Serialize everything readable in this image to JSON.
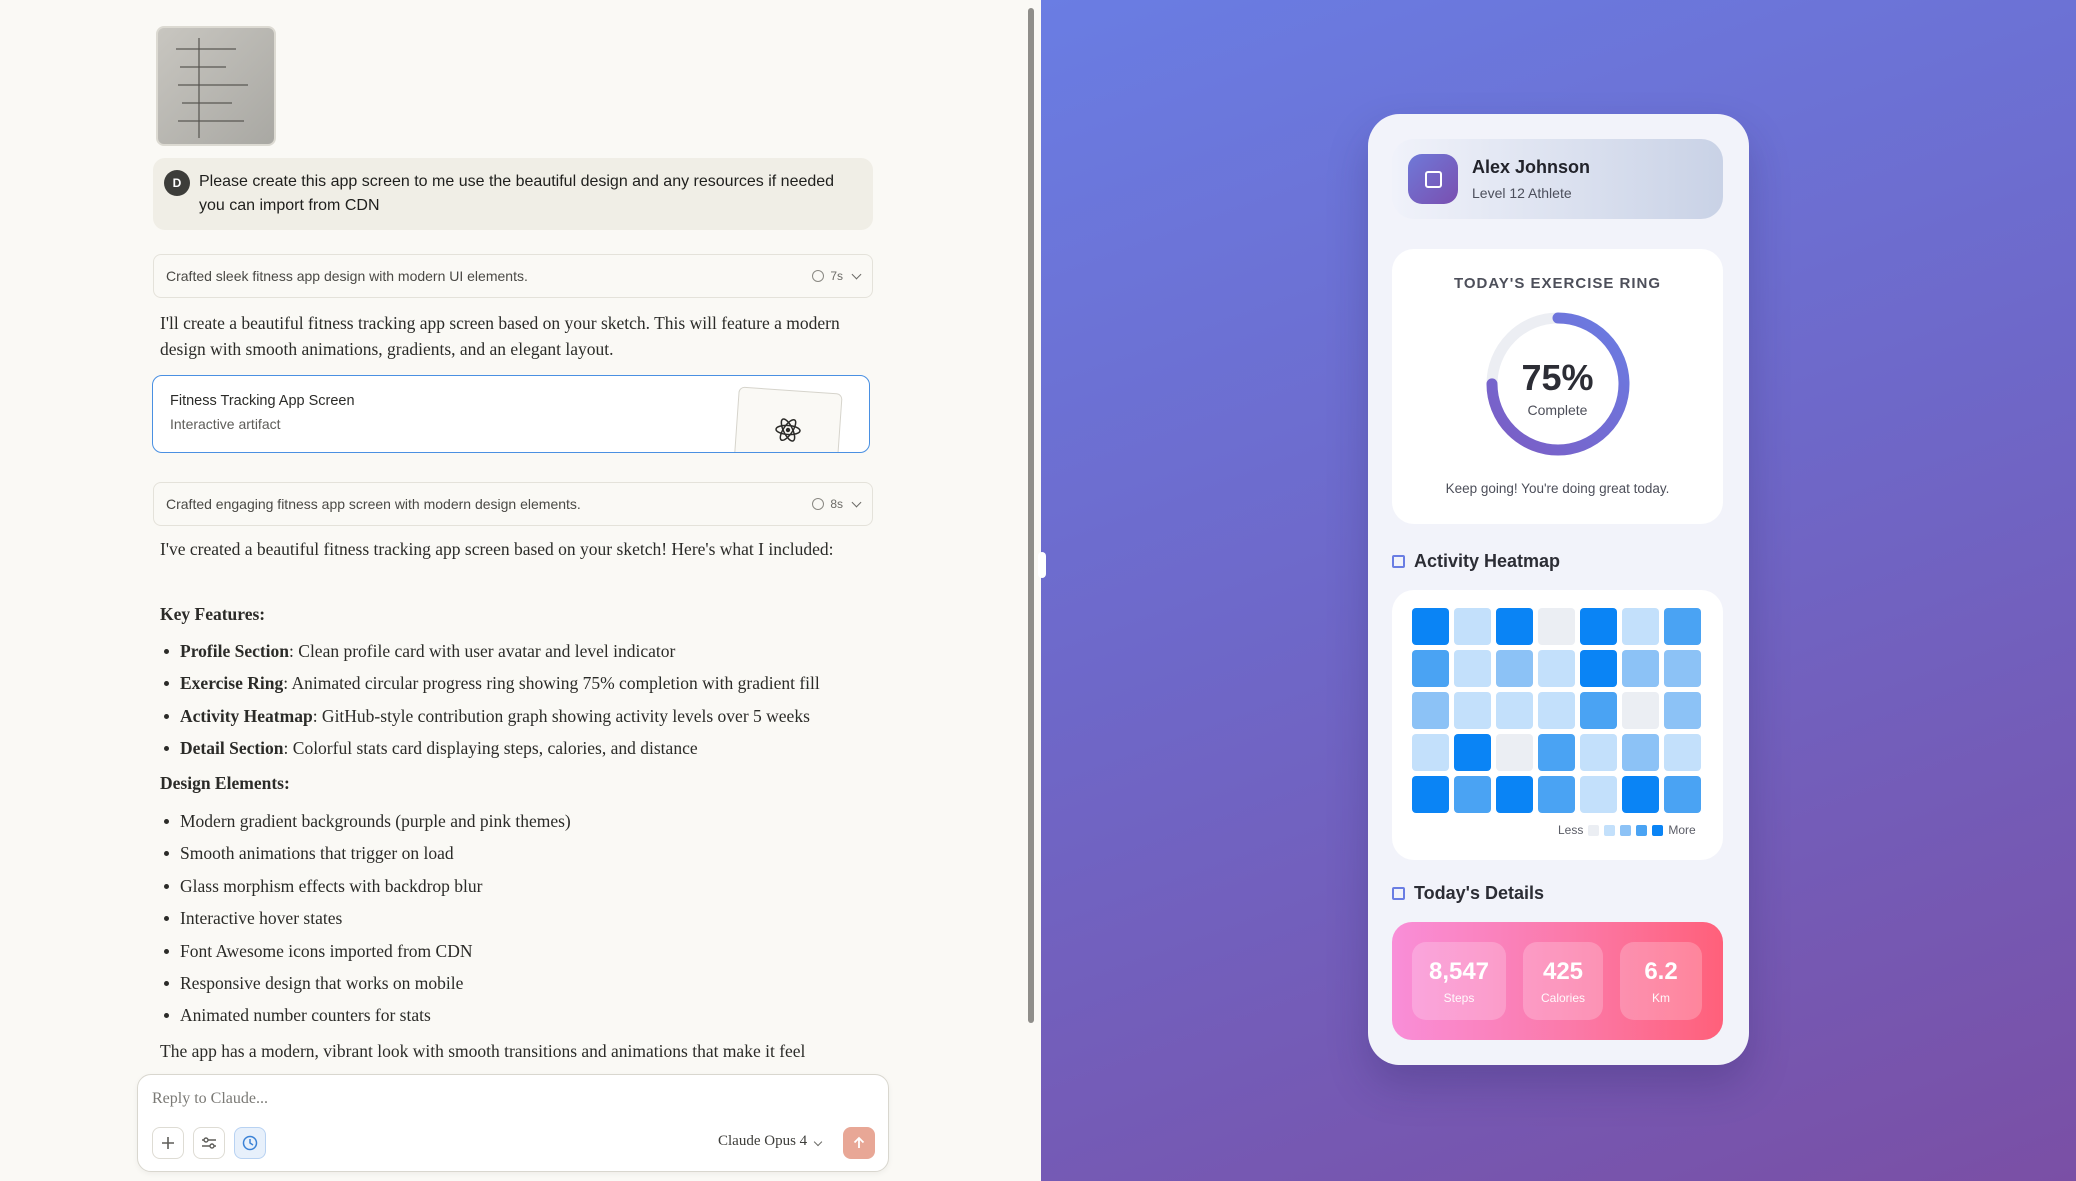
{
  "chat": {
    "user_avatar_initial": "D",
    "user_message": "Please create this app screen to me use the beautiful design and any resources if needed you can import from CDN",
    "thinking1": {
      "text": "Crafted sleek fitness app design with modern UI elements.",
      "duration": "7s"
    },
    "intro": "I'll create a beautiful fitness tracking app screen based on your sketch. This will feature a modern design with smooth animations, gradients, and an elegant layout.",
    "artifact": {
      "title": "Fitness Tracking App Screen",
      "subtitle": "Interactive artifact"
    },
    "thinking2": {
      "text": "Crafted engaging fitness app screen with modern design elements.",
      "duration": "8s"
    },
    "summary": "I've created a beautiful fitness tracking app screen based on your sketch! Here's what I included:",
    "key_features_heading": "Key Features:",
    "key_features": [
      {
        "bold": "Profile Section",
        "rest": ": Clean profile card with user avatar and level indicator"
      },
      {
        "bold": "Exercise Ring",
        "rest": ": Animated circular progress ring showing 75% completion with gradient fill"
      },
      {
        "bold": "Activity Heatmap",
        "rest": ": GitHub-style contribution graph showing activity levels over 5 weeks"
      },
      {
        "bold": "Detail Section",
        "rest": ": Colorful stats card displaying steps, calories, and distance"
      }
    ],
    "design_heading": "Design Elements:",
    "design_elements": [
      "Modern gradient backgrounds (purple and pink themes)",
      "Smooth animations that trigger on load",
      "Glass morphism effects with backdrop blur",
      "Interactive hover states",
      "Font Awesome icons imported from CDN",
      "Responsive design that works on mobile",
      "Animated number counters for stats"
    ],
    "closing": "The app has a modern, vibrant look with smooth transitions and animations that make it feel",
    "composer": {
      "placeholder": "Reply to Claude...",
      "model": "Claude Opus 4"
    }
  },
  "app": {
    "profile": {
      "name": "Alex Johnson",
      "level": "Level 12 Athlete"
    },
    "ring": {
      "title": "TODAY'S EXERCISE RING",
      "percent_label": "75%",
      "progress": 0.75,
      "sub": "Complete",
      "message": "Keep going! You're doing great today."
    },
    "heatmap": {
      "title": "Activity Heatmap",
      "levels": [
        [
          4,
          1,
          4,
          0,
          4,
          1,
          3
        ],
        [
          3,
          1,
          2,
          1,
          4,
          2,
          2
        ],
        [
          2,
          1,
          1,
          1,
          3,
          0,
          2
        ],
        [
          1,
          4,
          0,
          3,
          1,
          2,
          1
        ],
        [
          4,
          3,
          4,
          3,
          1,
          4,
          3
        ]
      ],
      "legend_less": "Less",
      "legend_more": "More",
      "colors": [
        "#ebeef3",
        "#c3e0fb",
        "#8cc2f6",
        "#4aa3f3",
        "#0a84f5"
      ]
    },
    "details": {
      "title": "Today's Details",
      "stats": [
        {
          "value": "8,547",
          "label": "Steps"
        },
        {
          "value": "425",
          "label": "Calories"
        },
        {
          "value": "6.2",
          "label": "Km"
        }
      ]
    }
  }
}
